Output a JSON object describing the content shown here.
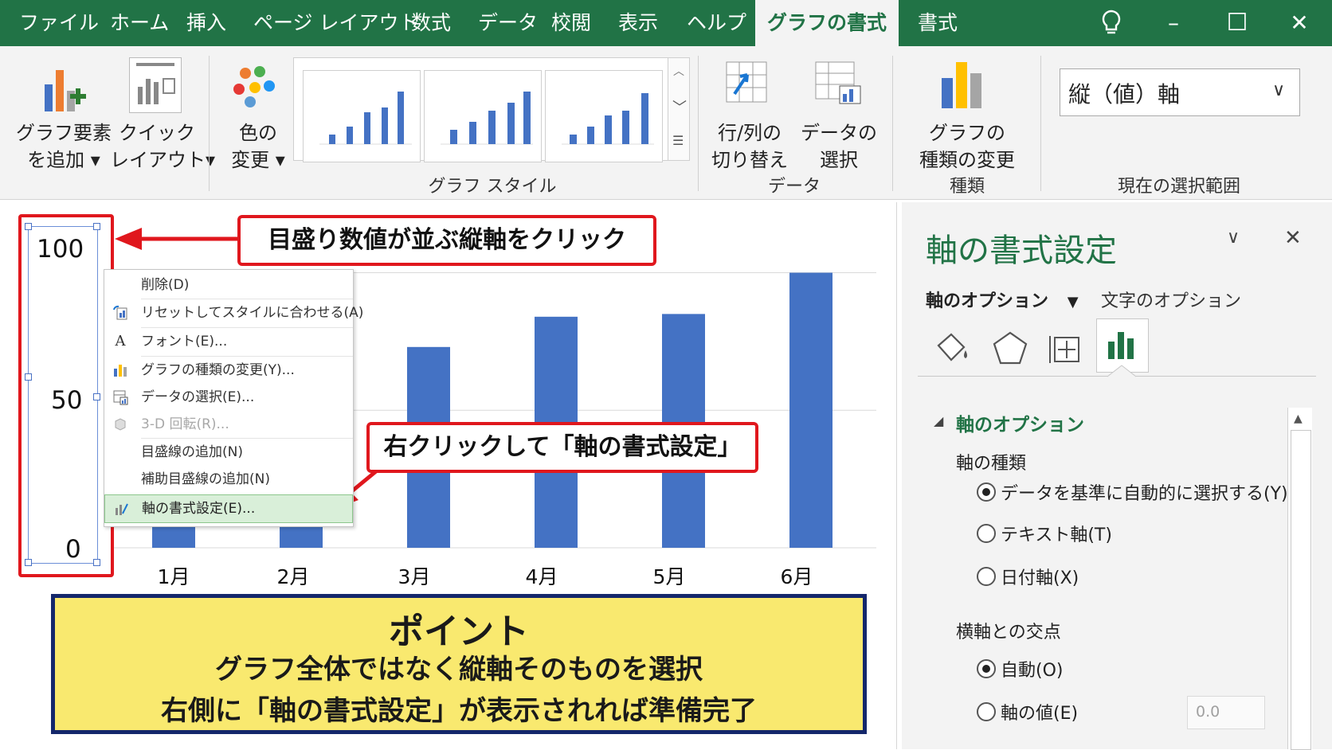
{
  "tabs": [
    {
      "label": "ファイル",
      "active": false
    },
    {
      "label": "ホーム",
      "active": false
    },
    {
      "label": "挿入",
      "active": false
    },
    {
      "label": "ページ レイアウト",
      "active": false
    },
    {
      "label": "数式",
      "active": false
    },
    {
      "label": "データ",
      "active": false
    },
    {
      "label": "校閲",
      "active": false
    },
    {
      "label": "表示",
      "active": false
    },
    {
      "label": "ヘルプ",
      "active": false
    },
    {
      "label": "グラフの書式",
      "active": true
    },
    {
      "label": "書式",
      "active": false
    }
  ],
  "window": {
    "minimize": "–",
    "maximize": "☐",
    "close": "✕",
    "lightbulb": "💡"
  },
  "ribbon": {
    "add_element": {
      "line1": "グラフ要素",
      "line2": "を追加 ▾"
    },
    "quick_layout": {
      "line1": "クイック",
      "line2": "レイアウト▾"
    },
    "change_color": {
      "line1": "色の",
      "line2": "変更 ▾"
    },
    "group_styles": "グラフ スタイル",
    "switch_rowcol": {
      "line1": "行/列の",
      "line2": "切り替え"
    },
    "select_data": {
      "line1": "データの",
      "line2": "選択"
    },
    "group_data": "データ",
    "change_type": {
      "line1": "グラフの",
      "line2": "種類の変更"
    },
    "group_type": "種類",
    "selection_value": "縦（値）軸",
    "group_selection": "現在の選択範囲"
  },
  "chart_data": {
    "type": "bar",
    "categories": [
      "1月",
      "2月",
      "3月",
      "4月",
      "5月",
      "6月"
    ],
    "values": [
      8,
      10,
      73,
      84,
      85,
      100
    ],
    "ylim": [
      0,
      110
    ],
    "yticks": [
      "100",
      "50",
      "0"
    ],
    "bar_color": "#4472c4",
    "grid": true
  },
  "callouts": {
    "axis": "目盛り数値が並ぶ縦軸をクリック",
    "format": "右クリックして「軸の書式設定」"
  },
  "context_menu": [
    {
      "label": "削除(D)",
      "icon": "",
      "disabled": false,
      "highlight": false
    },
    {
      "label": "リセットしてスタイルに合わせる(A)",
      "icon": "reset-style-icon",
      "disabled": false,
      "highlight": false
    },
    {
      "label": "フォント(E)...",
      "icon": "font-icon",
      "disabled": false,
      "highlight": false
    },
    {
      "label": "グラフの種類の変更(Y)...",
      "icon": "chart-type-icon",
      "disabled": false,
      "highlight": false
    },
    {
      "label": "データの選択(E)...",
      "icon": "select-data-icon",
      "disabled": false,
      "highlight": false
    },
    {
      "label": "3-D 回転(R)...",
      "icon": "rotate-3d-icon",
      "disabled": true,
      "highlight": false
    },
    {
      "label": "目盛線の追加(N)",
      "icon": "",
      "disabled": false,
      "highlight": false
    },
    {
      "label": "補助目盛線の追加(N)",
      "icon": "",
      "disabled": false,
      "highlight": false
    },
    {
      "label": "軸の書式設定(E)...",
      "icon": "format-axis-icon",
      "disabled": false,
      "highlight": true
    }
  ],
  "point": {
    "title": "ポイント",
    "line1": "グラフ全体ではなく縦軸そのものを選択",
    "line2": "右側に「軸の書式設定」が表示されれば準備完了"
  },
  "pane": {
    "title": "軸の書式設定",
    "tab_axis_options": "軸のオプション",
    "tab_text_options": "文字のオプション",
    "section": "軸のオプション",
    "axis_type_label": "軸の種類",
    "axis_types": [
      {
        "label": "データを基準に自動的に選択する(Y)",
        "checked": true
      },
      {
        "label": "テキスト軸(T)",
        "checked": false
      },
      {
        "label": "日付軸(X)",
        "checked": false
      }
    ],
    "cross_label": "横軸との交点",
    "cross_options": [
      {
        "label": "自動(O)",
        "checked": true
      },
      {
        "label": "軸の値(E)",
        "checked": false
      }
    ],
    "axis_value": "0.0",
    "accent": "#217346"
  }
}
